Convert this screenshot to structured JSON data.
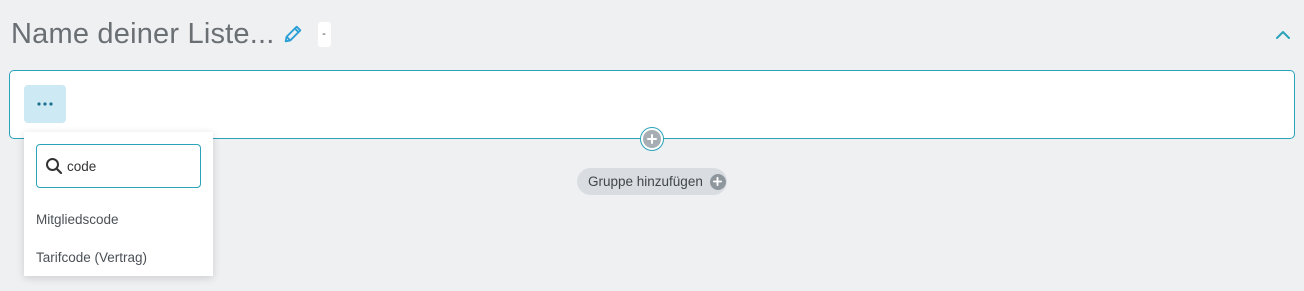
{
  "header": {
    "list_title": "Name deiner Liste...",
    "badge": "-",
    "edit_icon": "pencil-icon",
    "collapse_icon": "chevron-up-icon"
  },
  "group": {
    "more_icon": "ellipsis-icon",
    "add_condition_icon": "plus-circle-icon"
  },
  "add_group": {
    "label": "Gruppe hinzufügen",
    "icon": "plus-circle-icon"
  },
  "dropdown": {
    "search_value": "code",
    "search_icon": "search-icon",
    "options": [
      "Mitgliedscode",
      "Tarifcode (Vertrag)"
    ]
  },
  "colors": {
    "accent": "#2aa3ba",
    "background": "#eff0f2",
    "more_button_bg": "#cdeaf4",
    "pill_bg": "#d9dde1"
  }
}
